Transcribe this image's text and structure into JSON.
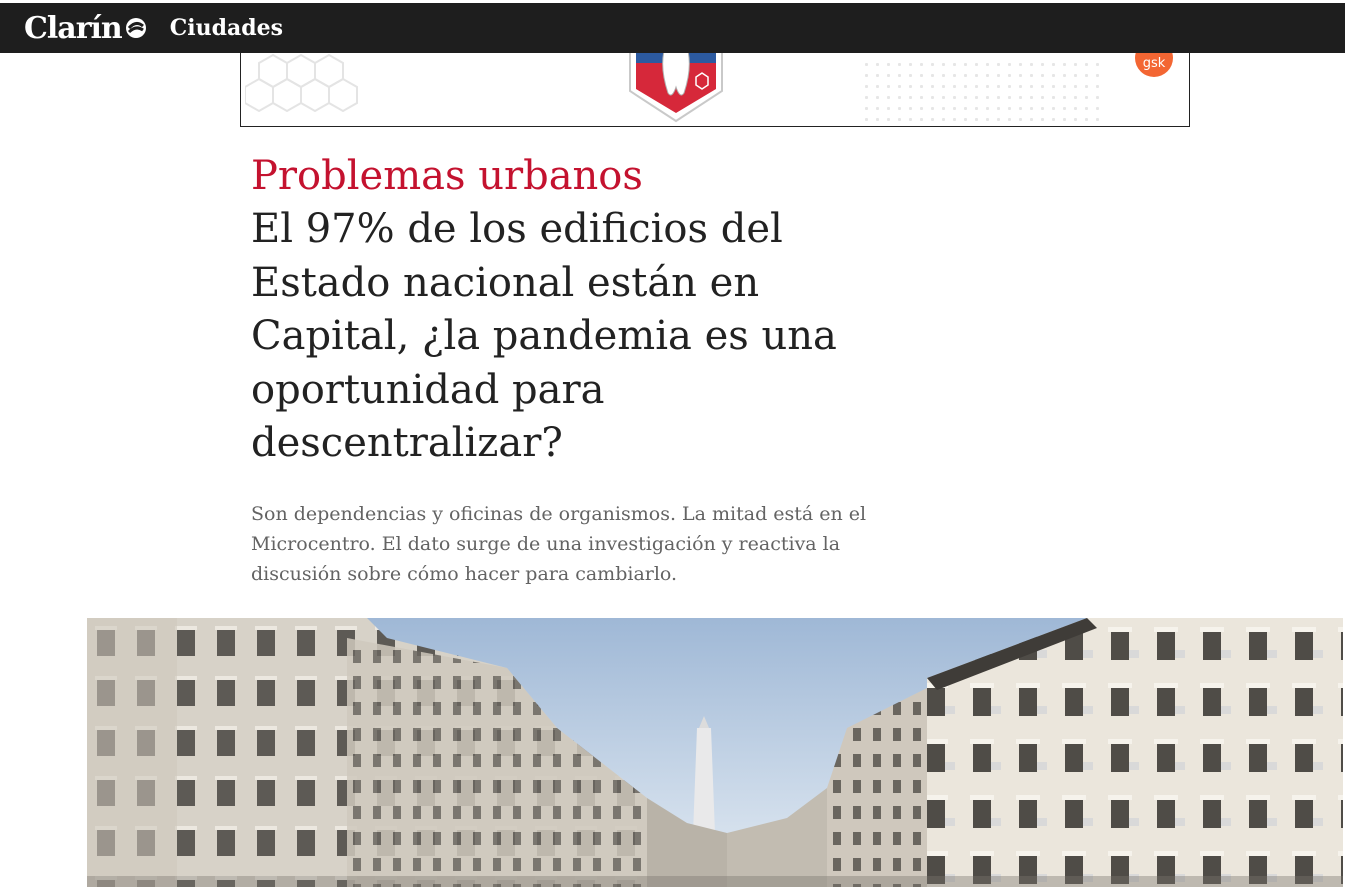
{
  "header": {
    "brand_name": "Clarín",
    "section_label": "Ciudades"
  },
  "advertisement": {
    "logo_text": "gsk"
  },
  "article": {
    "kicker": "Problemas urbanos",
    "headline": "El 97% de los edificios del Estado nacional están en Capital, ¿la pandemia es una oportunidad para descentralizar?",
    "summary": "Son dependencias y oficinas de organismos. La mitad está en el Microcentro. El dato surge de una investigación y reactiva la discusión sobre cómo hacer para cambiarlo."
  },
  "colors": {
    "topbar": "#1e1e1e",
    "kicker": "#c4122f",
    "headline": "#222222",
    "summary": "#636363"
  },
  "icons": {
    "brand_mark": "clarin-logo-icon"
  }
}
